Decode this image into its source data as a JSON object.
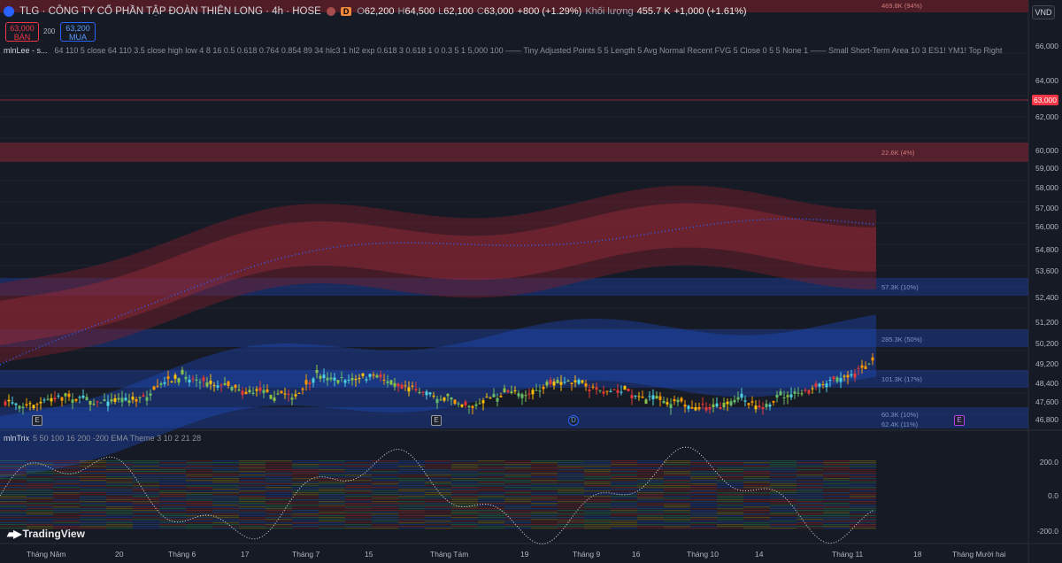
{
  "header": {
    "title": "TLG · CÔNG TY CỔ PHẦN TẬP ĐOÀN THIÊN LONG · 4h · HOSE",
    "d_badge": "D",
    "open_label": "O",
    "open": "62,200",
    "high_label": "H",
    "high": "64,500",
    "low_label": "L",
    "low": "62,100",
    "close_label": "C",
    "close": "63,000",
    "change": "+800 (+1.29%)",
    "volume_label": "Khối lượng",
    "volume": "455.7 K",
    "volume_change": "+1,000 (+1.61%)"
  },
  "trade": {
    "sell_price": "63,000",
    "sell_label": "BÁN",
    "spread": "200",
    "buy_price": "63,200",
    "buy_label": "MUA"
  },
  "currency": "VND",
  "indicator_1": {
    "name": "mlnLee - s...",
    "params": "64 110 5 close 64 110 3.5 close high low 4 8 16 0.5 0.618 0.764 0.854 89 34 hlc3 1 hl2 exp 0.618 3 0.618 1 0 0.3 5 1 5,000 100 —— Tiny Adjusted Points 5 5 Length 5 Avg Normal Recent FVG 5 Close 0 5 5 None 1 —— Small Short-Term Area 10 3 ES1! YM1! Top Right S..."
  },
  "indicator_2": {
    "name": "mlnTrix",
    "params": "5 50 100 16 200 -200 EMA Theme 3 10 2 21 28"
  },
  "price_axis": [
    "66,000",
    "64,000",
    "62,000",
    "60,000",
    "59,000",
    "58,000",
    "57,000",
    "56,000",
    "54,800",
    "53,600",
    "52,400",
    "51,200",
    "50,200",
    "49,200",
    "48,400",
    "47,600",
    "46,800"
  ],
  "last_price": "63,000",
  "trix_axis": [
    "200.0",
    "0.0",
    "-200.0"
  ],
  "time_axis": [
    "Tháng Năm",
    "20",
    "Tháng 6",
    "17",
    "Tháng 7",
    "15",
    "Tháng Tám",
    "19",
    "Tháng 9",
    "16",
    "Tháng 10",
    "14",
    "Tháng 11",
    "18",
    "Tháng Mười hai"
  ],
  "zone_labels": {
    "top": "469.8K (94%)",
    "red": "22.6K (4%)",
    "blue_1": "57.3K (10%)",
    "blue_2": "285.3K (50%)",
    "blue_3": "101.3K (17%)",
    "blue_4": "60.3K (10%)",
    "blue_5": "62.4K (11%)"
  },
  "badges": [
    "E",
    "E",
    "D",
    "E"
  ],
  "brand": "TradingView",
  "colors": {
    "up": "#26a69a",
    "down": "#ef5350",
    "accent": "#2962ff",
    "bg": "#161a25"
  }
}
